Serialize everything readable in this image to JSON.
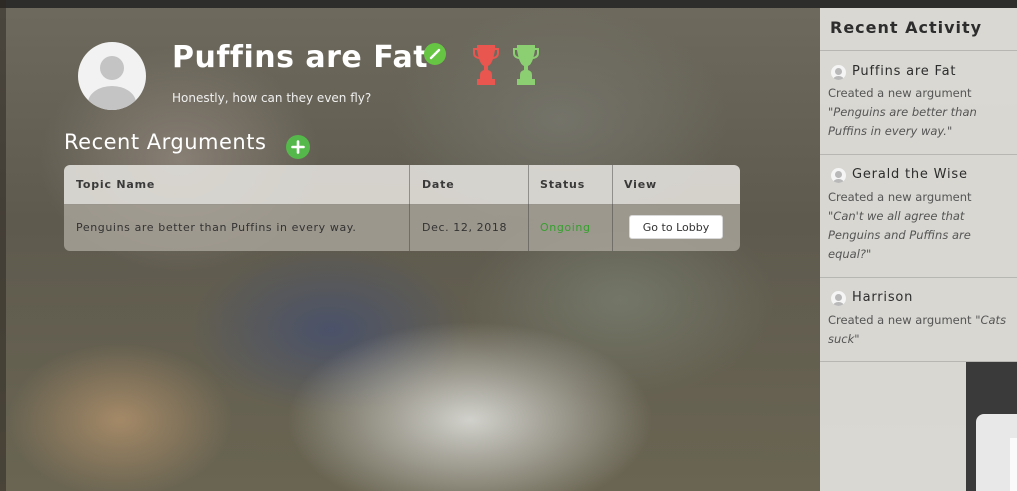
{
  "profile": {
    "name": "Puffins are Fat",
    "tagline": "Honestly, how can they even fly?"
  },
  "arguments": {
    "title": "Recent Arguments",
    "columns": [
      "Topic Name",
      "Date",
      "Status",
      "View"
    ],
    "rows": [
      {
        "topic": "Penguins are better than Puffins in every way.",
        "date": "Dec. 12, 2018",
        "status": "Ongoing",
        "action": "Go to Lobby"
      }
    ]
  },
  "activity": {
    "title": "Recent Activity",
    "items": [
      {
        "name": "Puffins are Fat",
        "line1": "Created a new argument",
        "line2": "\"Penguins are better than",
        "line3": "Puffins in every way.\"",
        "line4": ""
      },
      {
        "name": "Gerald the Wise",
        "line1": "Created a new argument",
        "line2": "\"Can't we all agree that",
        "line3": "Penguins and Puffins are",
        "line4": "equal?\""
      },
      {
        "name": "Harrison",
        "line1": "Created a new argument",
        "quote_inline": "\"Cats",
        "line2": "suck\""
      }
    ]
  },
  "colors": {
    "accent_green": "#66c542",
    "status_green": "#35a02d",
    "trophy_red": "#e8564f",
    "trophy_green": "#8ccf73"
  },
  "icons": [
    "edit-icon",
    "trophy-red-icon",
    "trophy-green-icon",
    "add-icon",
    "user-avatar-icon"
  ]
}
